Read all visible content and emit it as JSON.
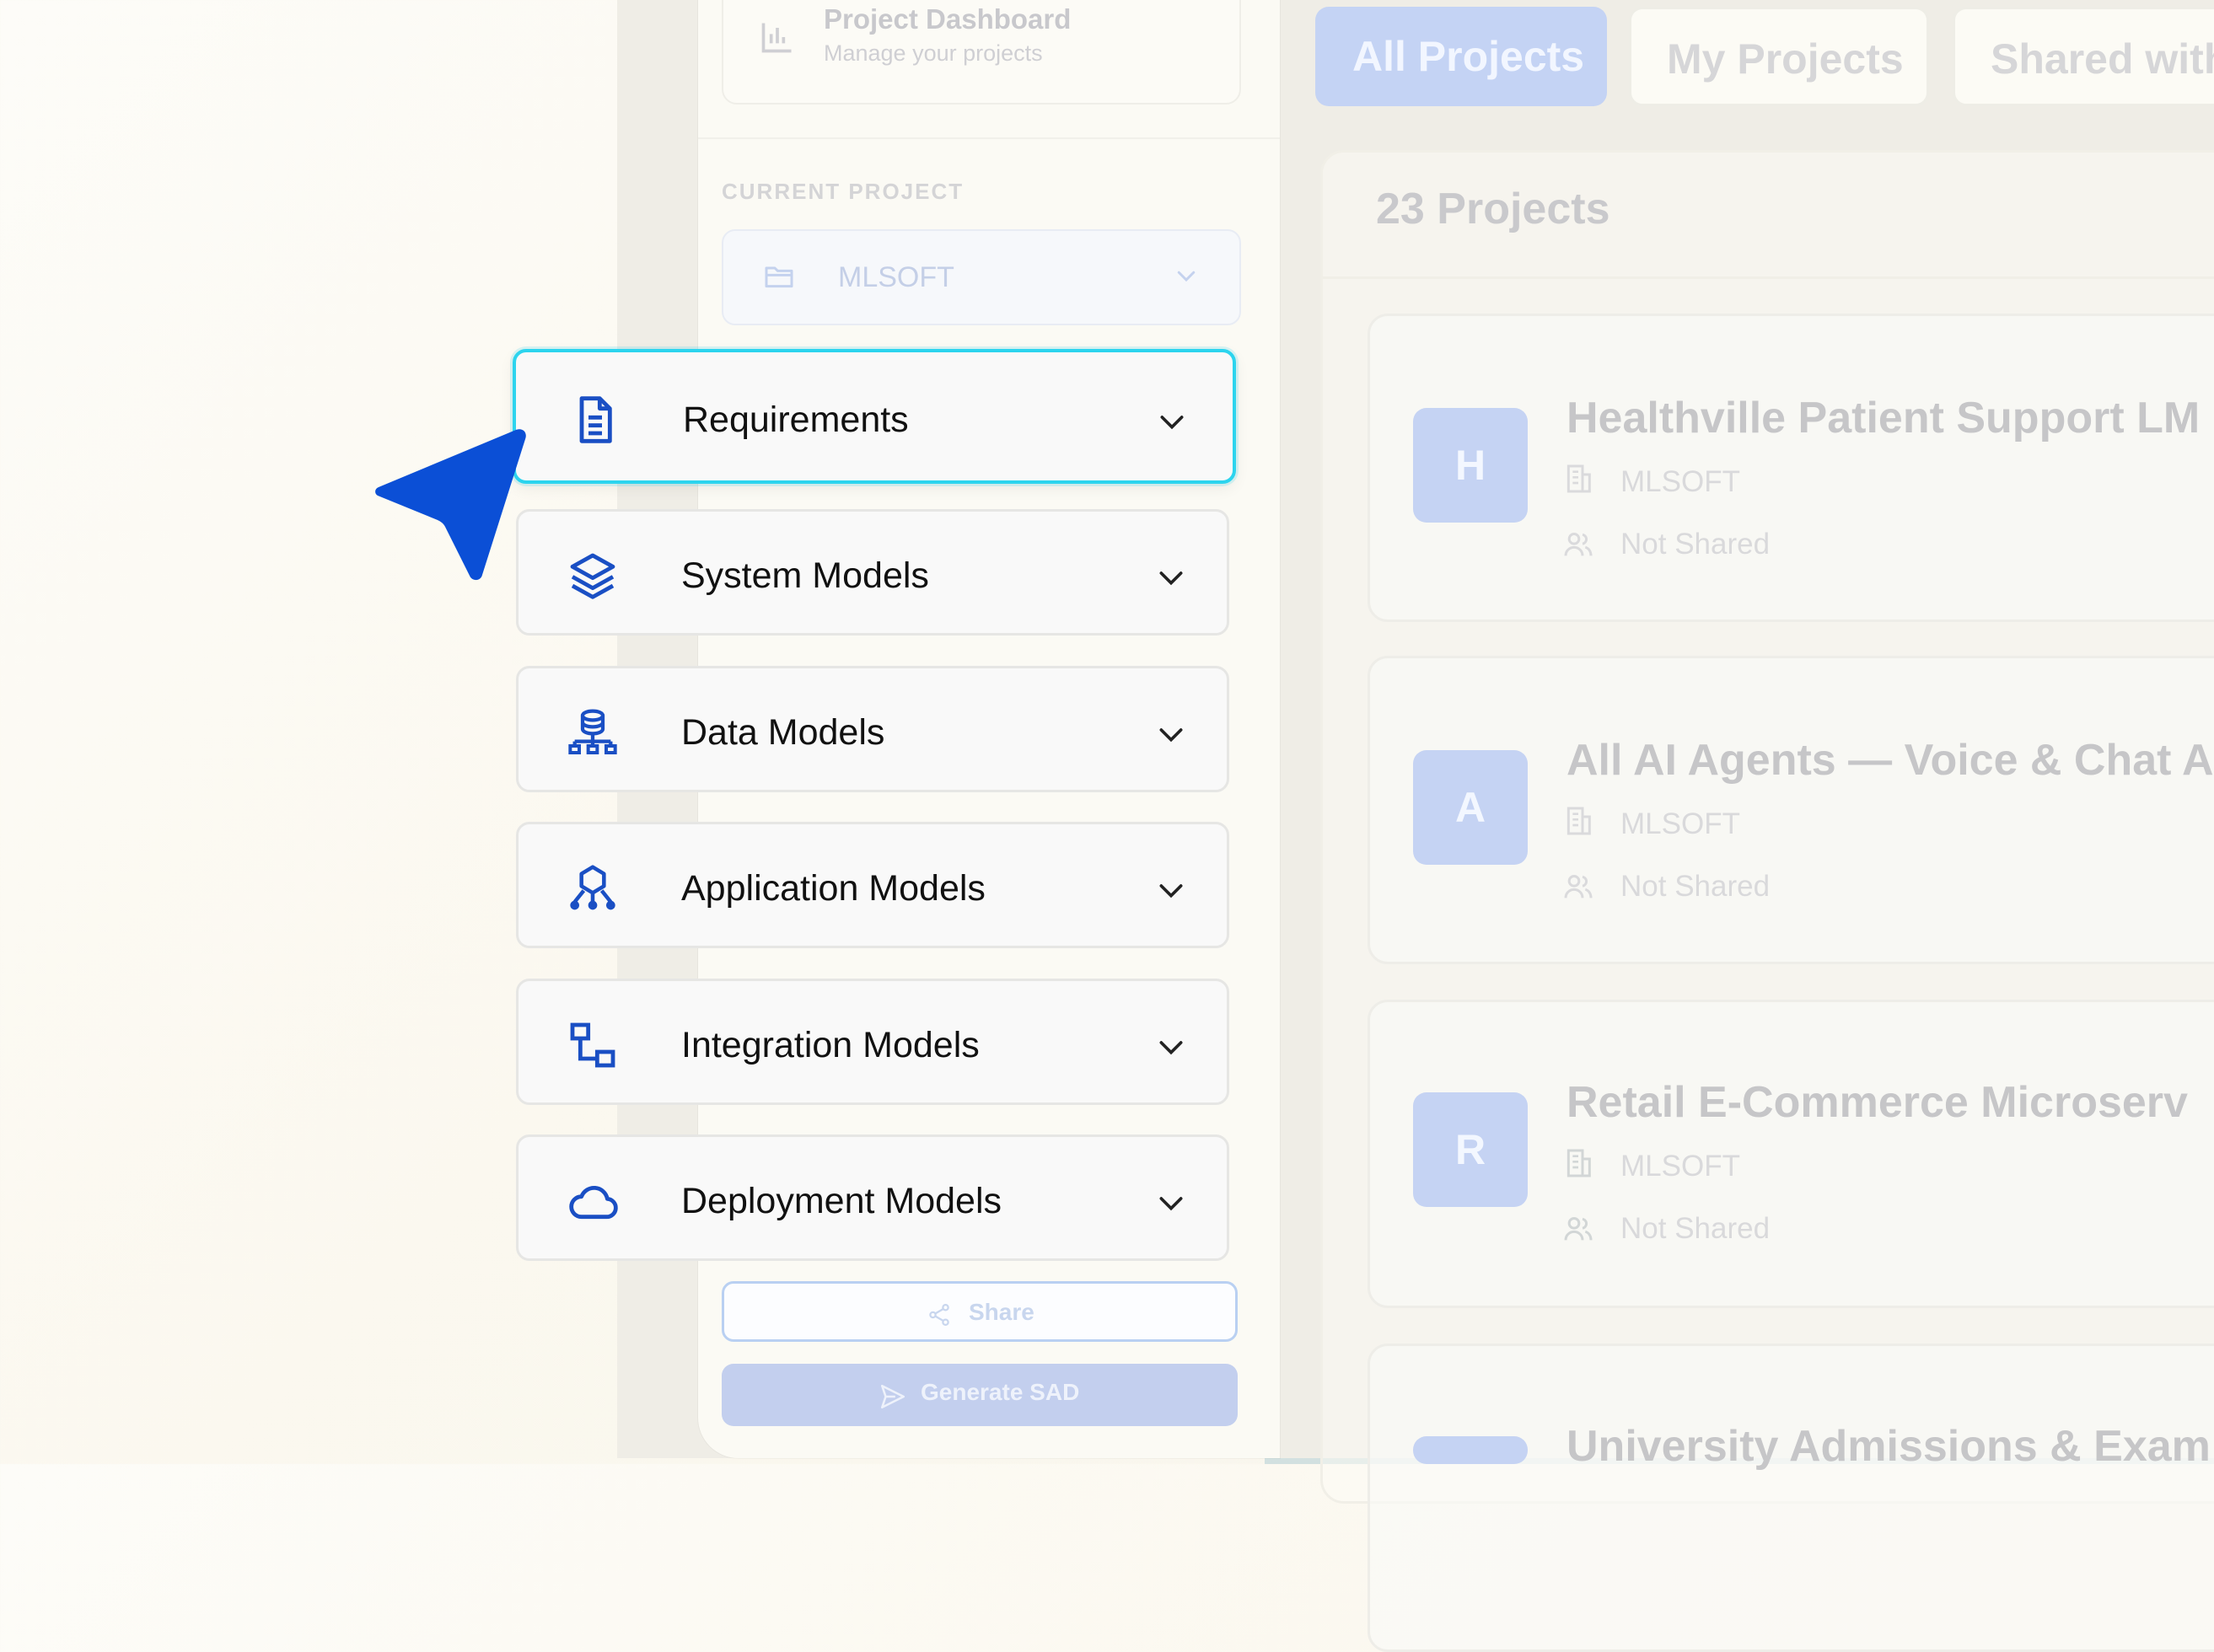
{
  "sidebar": {
    "title": "Project Dashboard",
    "subtitle": "Manage your projects",
    "current_project_label": "CURRENT PROJECT",
    "current_project": "MLSOFT",
    "nav_items": [
      {
        "label": "Requirements",
        "icon": "document-icon",
        "active": true
      },
      {
        "label": "System Models",
        "icon": "layers-icon",
        "active": false
      },
      {
        "label": "Data Models",
        "icon": "database-icon",
        "active": false
      },
      {
        "label": "Application Models",
        "icon": "network-icon",
        "active": false
      },
      {
        "label": "Integration Models",
        "icon": "connector-icon",
        "active": false
      },
      {
        "label": "Deployment Models",
        "icon": "cloud-icon",
        "active": false
      }
    ],
    "share_label": "Share",
    "generate_label": "Generate SAD"
  },
  "tabs": [
    {
      "label": "All Projects",
      "active": true
    },
    {
      "label": "My Projects",
      "active": false
    },
    {
      "label": "Shared with",
      "active": false
    }
  ],
  "projects": {
    "count_label": "23 Projects",
    "items": [
      {
        "initial": "H",
        "name": "Healthville Patient Support LM",
        "org": "MLSOFT",
        "sharing": "Not Shared"
      },
      {
        "initial": "A",
        "name": "All AI Agents — Voice & Chat A",
        "org": "MLSOFT",
        "sharing": "Not Shared"
      },
      {
        "initial": "R",
        "name": "Retail E-Commerce Microserv",
        "org": "MLSOFT",
        "sharing": "Not Shared"
      },
      {
        "initial": "",
        "name": "University Admissions & Exam",
        "org": "",
        "sharing": ""
      }
    ]
  },
  "colors": {
    "accent": "#0b4fd6",
    "active_border": "#2cd4ee",
    "icon_blue": "#1a4fc4"
  }
}
